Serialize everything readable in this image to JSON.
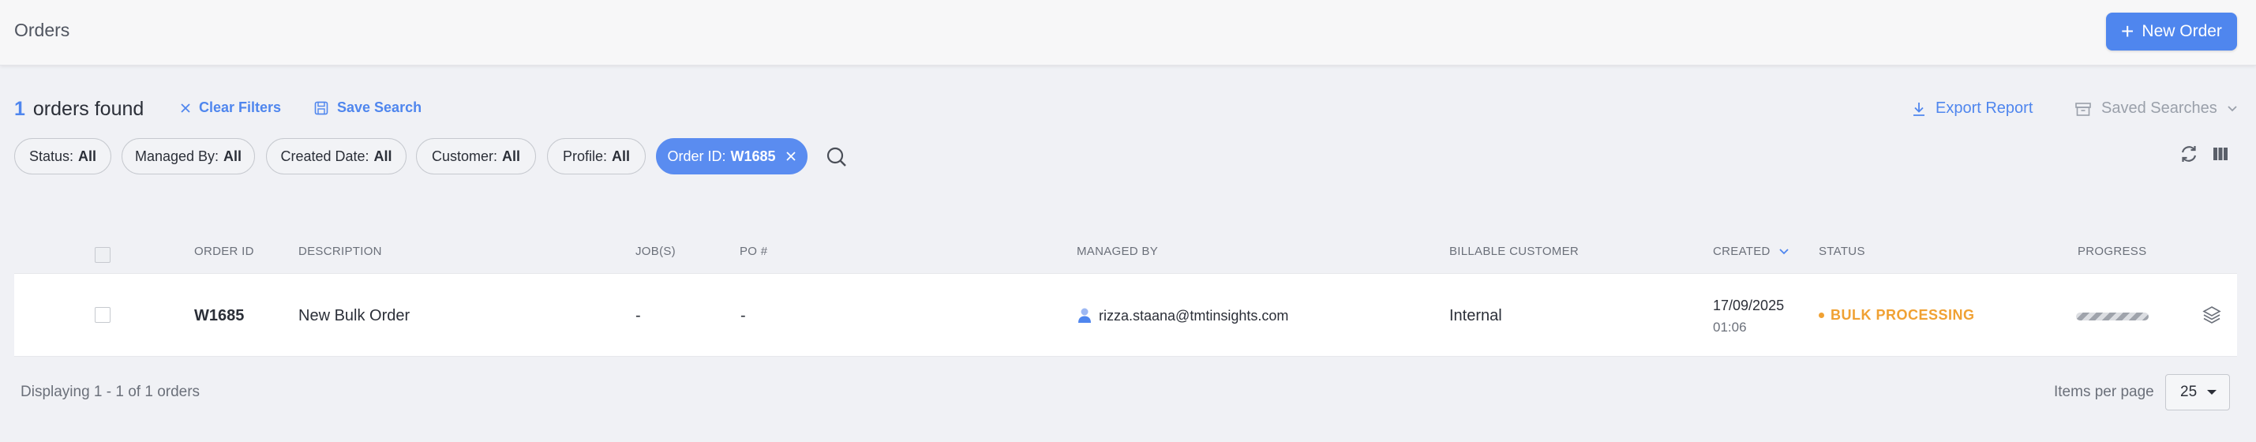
{
  "header": {
    "title": "Orders",
    "new_order_label": "New Order"
  },
  "summary": {
    "count": "1",
    "label": "orders found",
    "clear_filters": "Clear Filters",
    "save_search": "Save Search",
    "export_report": "Export Report",
    "saved_searches": "Saved Searches"
  },
  "filters": [
    {
      "label": "Status:",
      "value": "All"
    },
    {
      "label": "Managed By:",
      "value": "All"
    },
    {
      "label": "Created Date:",
      "value": "All"
    },
    {
      "label": "Customer:",
      "value": "All"
    },
    {
      "label": "Profile:",
      "value": "All"
    },
    {
      "label": "Order ID:",
      "value": "W1685"
    }
  ],
  "table": {
    "columns": [
      "ORDER ID",
      "DESCRIPTION",
      "JOB(S)",
      "PO #",
      "MANAGED BY",
      "BILLABLE CUSTOMER",
      "CREATED",
      "STATUS",
      "PROGRESS"
    ],
    "sort_column": "CREATED",
    "rows": [
      {
        "order_id": "W1685",
        "description": "New Bulk Order",
        "jobs": "-",
        "po": "-",
        "managed_by": "rizza.staana@tmtinsights.com",
        "billable_customer": "Internal",
        "created_date": "17/09/2025",
        "created_time": "01:06",
        "status": "BULK PROCESSING",
        "progress": "indeterminate"
      }
    ]
  },
  "footer": {
    "displaying": "Displaying 1 - 1 of 1 orders",
    "items_per_page_label": "Items per page",
    "items_per_page": "25"
  },
  "colors": {
    "accent": "#4f86ee",
    "status_processing": "#f0a133",
    "background": "#f0f1f5"
  },
  "icons": [
    "plus-icon",
    "close-icon",
    "save-icon",
    "download-icon",
    "archive-icon",
    "chevron-down-icon",
    "search-icon",
    "refresh-icon",
    "columns-icon",
    "user-icon",
    "layers-icon",
    "sort-down-icon"
  ]
}
